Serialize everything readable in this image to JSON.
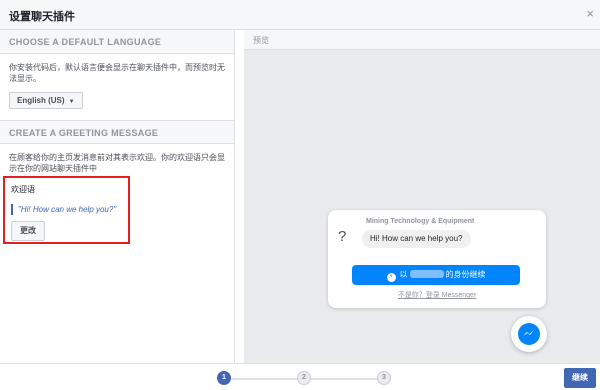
{
  "dialog": {
    "title": "设置聊天插件",
    "close_glyph": "×"
  },
  "language_section": {
    "heading": "CHOOSE A DEFAULT LANGUAGE",
    "description": "你安装代码后，默认语言便会显示在聊天插件中，而预览时无法显示。",
    "selected_language": "English (US)"
  },
  "greeting_section": {
    "heading": "CREATE A GREETING MESSAGE",
    "description": "在顾客给你的主页发消息前对其表示欢迎。你的欢迎语只会显示在你的网站聊天插件中",
    "label": "欢迎语",
    "greeting_text": "\"Hi! How can we help you?\"",
    "change_button": "更改"
  },
  "preview": {
    "heading": "预览",
    "page_name": "Mining Technology & Equipment",
    "bubble_text": "Hi! How can we help you?",
    "continue_prefix": "以",
    "continue_suffix": "的身份继续",
    "not_you_link": "不是你？登录 Messenger"
  },
  "stepper": {
    "steps": [
      "1",
      "2",
      "3"
    ],
    "active_step": 1
  },
  "footer": {
    "next_button": "继续"
  },
  "colors": {
    "brand_blue": "#4267b2",
    "messenger_blue": "#0084ff",
    "highlight_red": "#e02020"
  }
}
